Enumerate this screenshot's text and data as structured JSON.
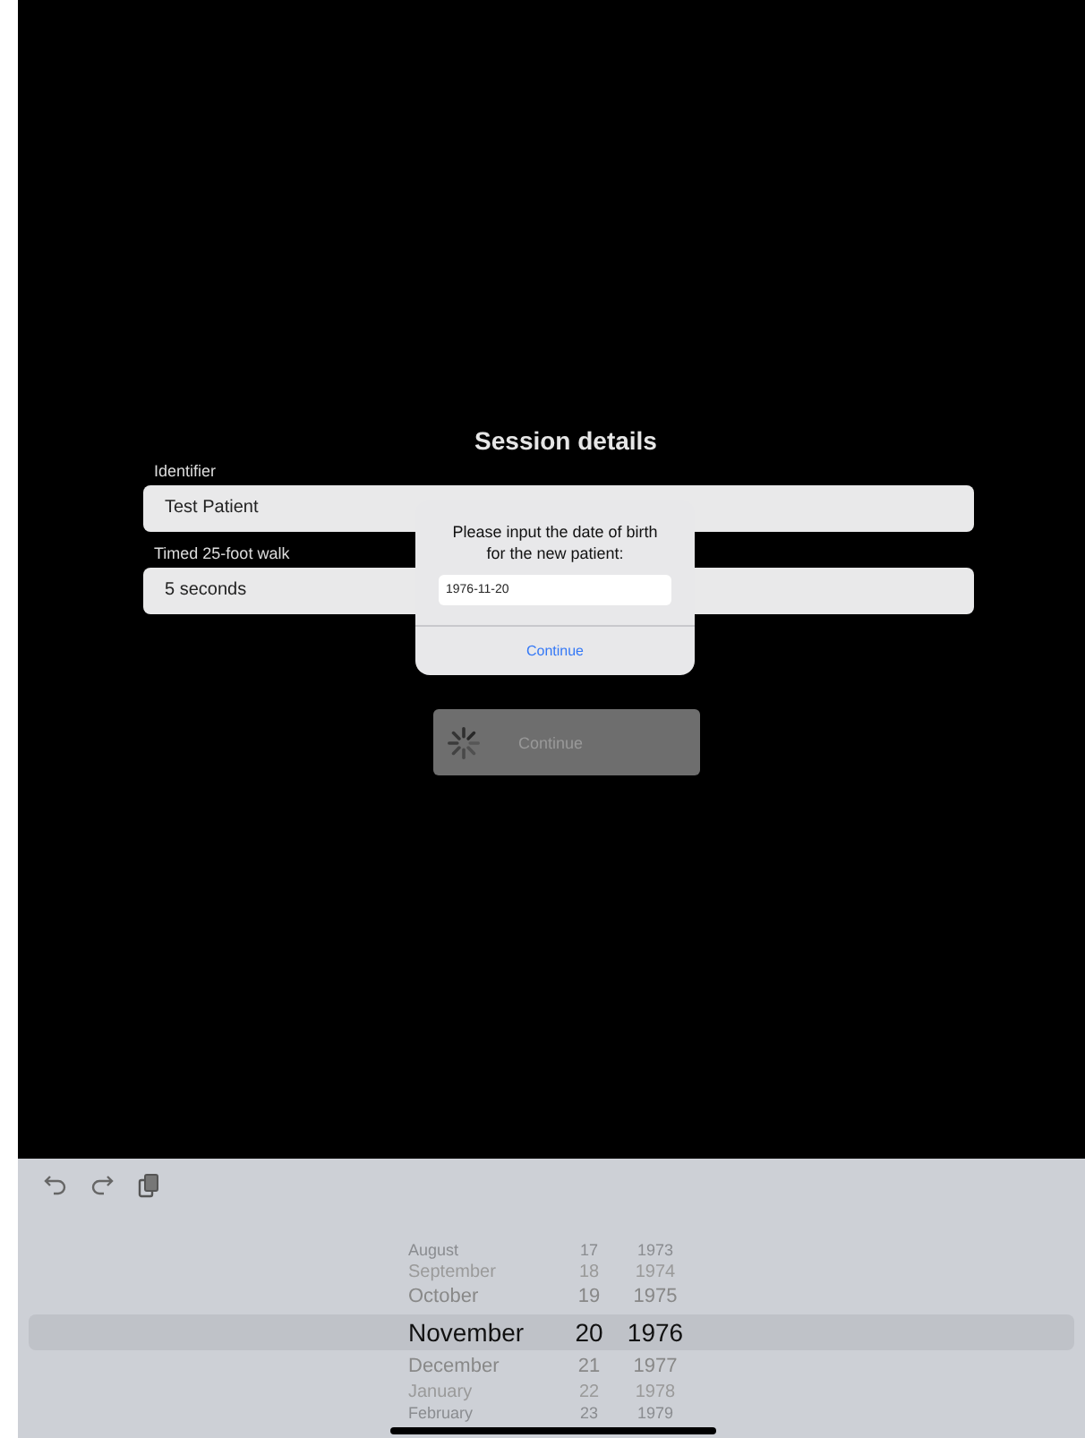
{
  "title": "Session details",
  "fields": [
    {
      "label": "Identifier",
      "value": "Test Patient"
    },
    {
      "label": "Timed 25-foot walk",
      "value": "5 seconds"
    }
  ],
  "continue_button": {
    "label": "Continue",
    "loading": true,
    "disabled": true
  },
  "alert": {
    "message": "Please input the date of birth for the new patient:",
    "value": "1976-11-20",
    "action": "Continue"
  },
  "picker": {
    "rows": [
      {
        "month": "August",
        "day": "17",
        "year": "1973",
        "selected": false
      },
      {
        "month": "September",
        "day": "18",
        "year": "1974",
        "selected": false
      },
      {
        "month": "October",
        "day": "19",
        "year": "1975",
        "selected": false
      },
      {
        "month": "November",
        "day": "20",
        "year": "1976",
        "selected": true
      },
      {
        "month": "December",
        "day": "21",
        "year": "1977",
        "selected": false
      },
      {
        "month": "January",
        "day": "22",
        "year": "1978",
        "selected": false
      },
      {
        "month": "February",
        "day": "23",
        "year": "1979",
        "selected": false
      }
    ]
  }
}
